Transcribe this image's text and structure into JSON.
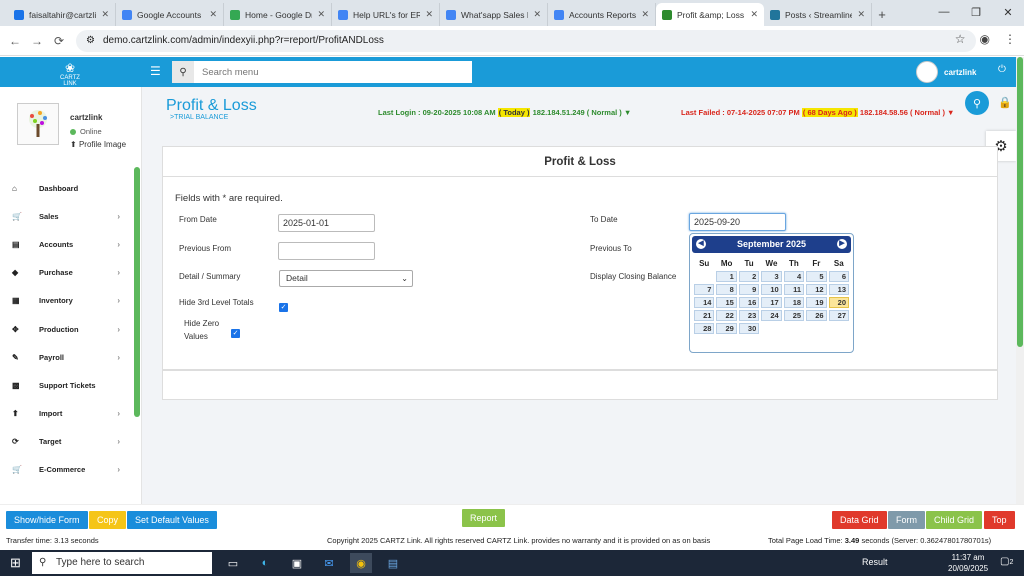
{
  "browser": {
    "tabs": [
      {
        "label": "faisaltahir@cartzli",
        "color": "#1a73e8"
      },
      {
        "label": "Google Accounts",
        "color": "#4285f4"
      },
      {
        "label": "Home - Google Dri",
        "color": "#34a853"
      },
      {
        "label": "Help URL's for ERI",
        "color": "#4285f4"
      },
      {
        "label": "What'sapp Sales N",
        "color": "#4285f4"
      },
      {
        "label": "Accounts Reports",
        "color": "#4285f4"
      },
      {
        "label": "Profit &amp; Loss",
        "color": "#2e8b2e"
      },
      {
        "label": "Posts ‹ Streamline",
        "color": "#21759b"
      }
    ],
    "url": "demo.cartzlink.com/admin/indexyii.php?r=report/ProfitANDLoss"
  },
  "header": {
    "search_placeholder": "Search menu",
    "user_name": "cartzlink",
    "logo_text": "CARTZ LINK"
  },
  "profile": {
    "name": "cartzlink",
    "status": "Online",
    "image_link": "Profile Image"
  },
  "sidebar": {
    "items": [
      {
        "label": "Dashboard",
        "icon": "home-icon",
        "glyph": "⌂",
        "chevron": ""
      },
      {
        "label": "Sales",
        "icon": "cart-icon",
        "glyph": "🛒",
        "chevron": "›"
      },
      {
        "label": "Accounts",
        "icon": "bank-icon",
        "glyph": "▤",
        "chevron": "›"
      },
      {
        "label": "Purchase",
        "icon": "tag-icon",
        "glyph": "◆",
        "chevron": "›"
      },
      {
        "label": "Inventory",
        "icon": "grid-icon",
        "glyph": "▦",
        "chevron": "›"
      },
      {
        "label": "Production",
        "icon": "cross-arrows-icon",
        "glyph": "✥",
        "chevron": "›"
      },
      {
        "label": "Payroll",
        "icon": "payroll-icon",
        "glyph": "✎",
        "chevron": "›"
      },
      {
        "label": "Support Tickets",
        "icon": "tickets-icon",
        "glyph": "▩",
        "chevron": ""
      },
      {
        "label": "Import",
        "icon": "upload-icon",
        "glyph": "⬆",
        "chevron": "›"
      },
      {
        "label": "Target",
        "icon": "refresh-icon",
        "glyph": "⟳",
        "chevron": "›"
      },
      {
        "label": "E-Commerce",
        "icon": "cart-icon",
        "glyph": "🛒",
        "chevron": "›"
      }
    ]
  },
  "page": {
    "title": "Profit & Loss",
    "subtitle": ">TRIAL BALANCE",
    "last_login_prefix": "Last Login : 09-20-2025 10:08 AM",
    "last_login_badge": "( Today )",
    "last_login_suffix": "182.184.51.249 ( Normal ) ▼",
    "last_failed_prefix": "Last Failed : 07-14-2025 07:07 PM",
    "last_failed_badge": "( 68 Days Ago )",
    "last_failed_suffix": "182.184.58.56 ( Normal ) ▼"
  },
  "form": {
    "heading": "Profit & Loss",
    "required_note": "Fields with * are required.",
    "from_date_label": "From Date",
    "from_date_value": "2025-01-01",
    "to_date_label": "To Date",
    "to_date_value": "2025-09-20",
    "previous_from_label": "Previous From",
    "previous_from_value": "",
    "previous_to_label": "Previous To",
    "detail_summary_label": "Detail / Summary",
    "detail_summary_value": "Detail",
    "display_closing_label": "Display Closing Balance",
    "hide_3rd_label": "Hide 3rd Level Totals",
    "hide_3rd_checked": true,
    "hide_zero_label_1": "Hide Zero",
    "hide_zero_label_2": "Values",
    "hide_zero_checked": true
  },
  "datepicker": {
    "month_title": "September 2025",
    "weekdays": [
      "Su",
      "Mo",
      "Tu",
      "We",
      "Th",
      "Fr",
      "Sa"
    ],
    "weeks": [
      [
        "",
        "1",
        "2",
        "3",
        "4",
        "5",
        "6"
      ],
      [
        "7",
        "8",
        "9",
        "10",
        "11",
        "12",
        "13"
      ],
      [
        "14",
        "15",
        "16",
        "17",
        "18",
        "19",
        "20"
      ],
      [
        "21",
        "22",
        "23",
        "24",
        "25",
        "26",
        "27"
      ],
      [
        "28",
        "29",
        "30",
        "",
        "",
        "",
        ""
      ]
    ],
    "selected_day": "20"
  },
  "bottom": {
    "show_hide_form": "Show/hide Form",
    "copy": "Copy",
    "set_default": "Set Default Values",
    "report": "Report",
    "data_grid": "Data Grid",
    "form": "Form",
    "child_grid": "Child Grid",
    "top": "Top",
    "transfer_time": "Transfer time: 3.13 seconds",
    "copyright": "Copyright 2025 CARTZ Link. All rights reserved CARTZ Link. provides no warranty and it is provided on as on basis",
    "load_time_prefix": "Total Page Load Time:",
    "load_time_value": "3.49",
    "load_time_suffix": "seconds (Server: 0.36247801780701s)",
    "colors": {
      "blue": "#1a8ddb",
      "yellow": "#f5c518",
      "green": "#8bc34a",
      "red": "#e0392b",
      "gray": "#7f9aaa"
    }
  },
  "taskbar": {
    "search_placeholder": "Type here to search",
    "result_label": "Result",
    "time": "11:37 am",
    "date": "20/09/2025",
    "notification_count": "2"
  }
}
